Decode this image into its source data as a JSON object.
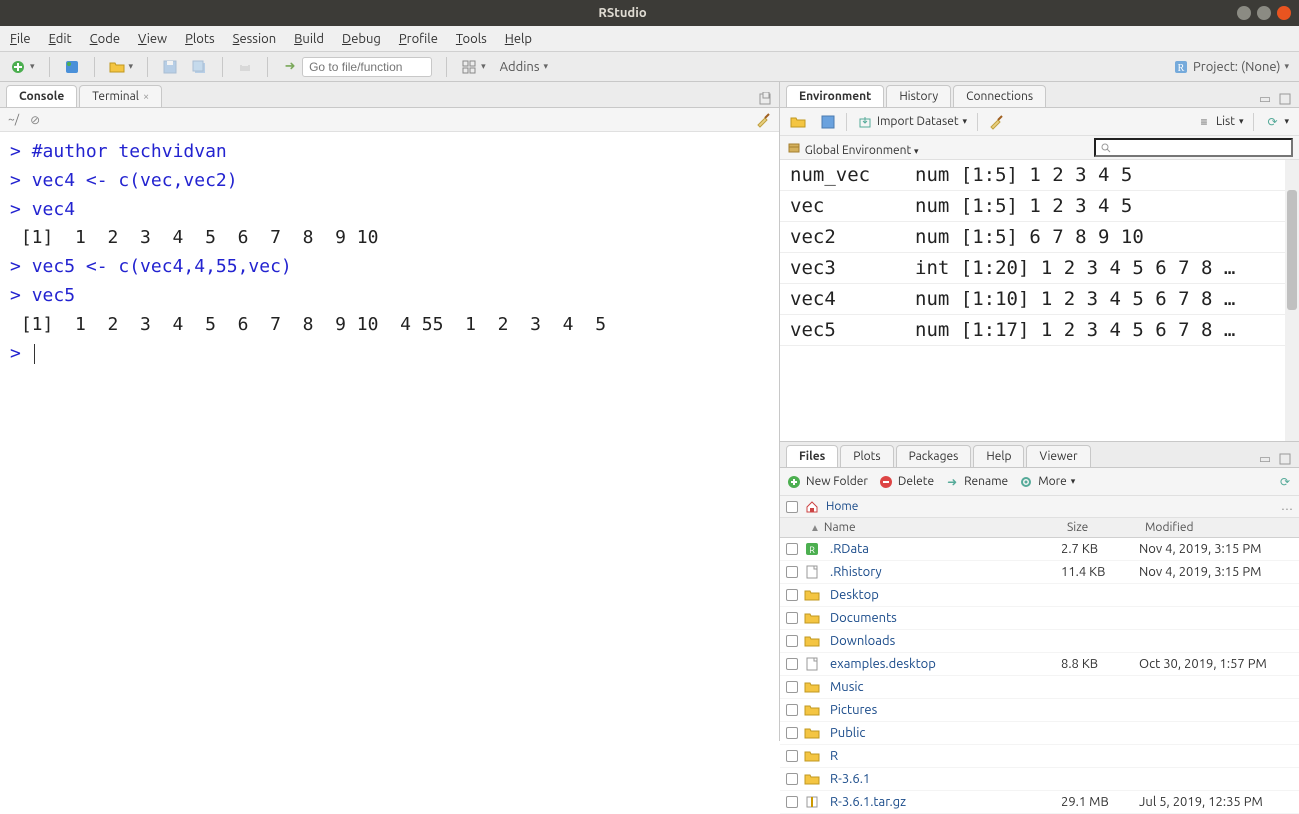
{
  "window": {
    "title": "RStudio"
  },
  "menu": [
    "File",
    "Edit",
    "Code",
    "View",
    "Plots",
    "Session",
    "Build",
    "Debug",
    "Profile",
    "Tools",
    "Help"
  ],
  "toolbar": {
    "goto_placeholder": "Go to file/function",
    "addins_label": "Addins",
    "project_label": "Project: (None)"
  },
  "left": {
    "tabs": {
      "console": "Console",
      "terminal": "Terminal"
    },
    "prompt_path": "~/",
    "console": {
      "lines": [
        {
          "type": "input",
          "text": "#author techvidvan"
        },
        {
          "type": "input",
          "text": "vec4 <- c(vec,vec2)"
        },
        {
          "type": "input",
          "text": "vec4"
        },
        {
          "type": "output",
          "text": " [1]  1  2  3  4  5  6  7  8  9 10"
        },
        {
          "type": "input",
          "text": "vec5 <- c(vec4,4,55,vec)"
        },
        {
          "type": "input",
          "text": "vec5"
        },
        {
          "type": "output",
          "text": " [1]  1  2  3  4  5  6  7  8  9 10  4 55  1  2  3  4  5"
        },
        {
          "type": "prompt_only",
          "text": ""
        }
      ]
    }
  },
  "env": {
    "tabs": {
      "environment": "Environment",
      "history": "History",
      "connections": "Connections"
    },
    "import_label": "Import Dataset",
    "list_label": "List",
    "scope_label": "Global Environment",
    "vars": [
      {
        "name": "num_vec",
        "value": "num [1:5] 1 2 3 4 5"
      },
      {
        "name": "vec",
        "value": "num [1:5] 1 2 3 4 5"
      },
      {
        "name": "vec2",
        "value": "num [1:5] 6 7 8 9 10"
      },
      {
        "name": "vec3",
        "value": "int [1:20] 1 2 3 4 5 6 7 8 …"
      },
      {
        "name": "vec4",
        "value": "num [1:10] 1 2 3 4 5 6 7 8 …"
      },
      {
        "name": "vec5",
        "value": "num [1:17] 1 2 3 4 5 6 7 8 …"
      }
    ]
  },
  "files": {
    "tabs": {
      "files": "Files",
      "plots": "Plots",
      "packages": "Packages",
      "help": "Help",
      "viewer": "Viewer"
    },
    "tool": {
      "new_folder": "New Folder",
      "delete": "Delete",
      "rename": "Rename",
      "more": "More"
    },
    "home_label": "Home",
    "cols": {
      "name": "Name",
      "size": "Size",
      "modified": "Modified"
    },
    "rows": [
      {
        "icon": "rdata",
        "name": ".RData",
        "size": "2.7 KB",
        "modified": "Nov 4, 2019, 3:15 PM"
      },
      {
        "icon": "file",
        "name": ".Rhistory",
        "size": "11.4 KB",
        "modified": "Nov 4, 2019, 3:15 PM"
      },
      {
        "icon": "folder",
        "name": "Desktop",
        "size": "",
        "modified": ""
      },
      {
        "icon": "folder",
        "name": "Documents",
        "size": "",
        "modified": ""
      },
      {
        "icon": "folder",
        "name": "Downloads",
        "size": "",
        "modified": ""
      },
      {
        "icon": "file",
        "name": "examples.desktop",
        "size": "8.8 KB",
        "modified": "Oct 30, 2019, 1:57 PM"
      },
      {
        "icon": "folder",
        "name": "Music",
        "size": "",
        "modified": ""
      },
      {
        "icon": "folder",
        "name": "Pictures",
        "size": "",
        "modified": ""
      },
      {
        "icon": "folder",
        "name": "Public",
        "size": "",
        "modified": ""
      },
      {
        "icon": "folder",
        "name": "R",
        "size": "",
        "modified": ""
      },
      {
        "icon": "folder",
        "name": "R-3.6.1",
        "size": "",
        "modified": ""
      },
      {
        "icon": "archive",
        "name": "R-3.6.1.tar.gz",
        "size": "29.1 MB",
        "modified": "Jul 5, 2019, 12:35 PM"
      }
    ]
  }
}
